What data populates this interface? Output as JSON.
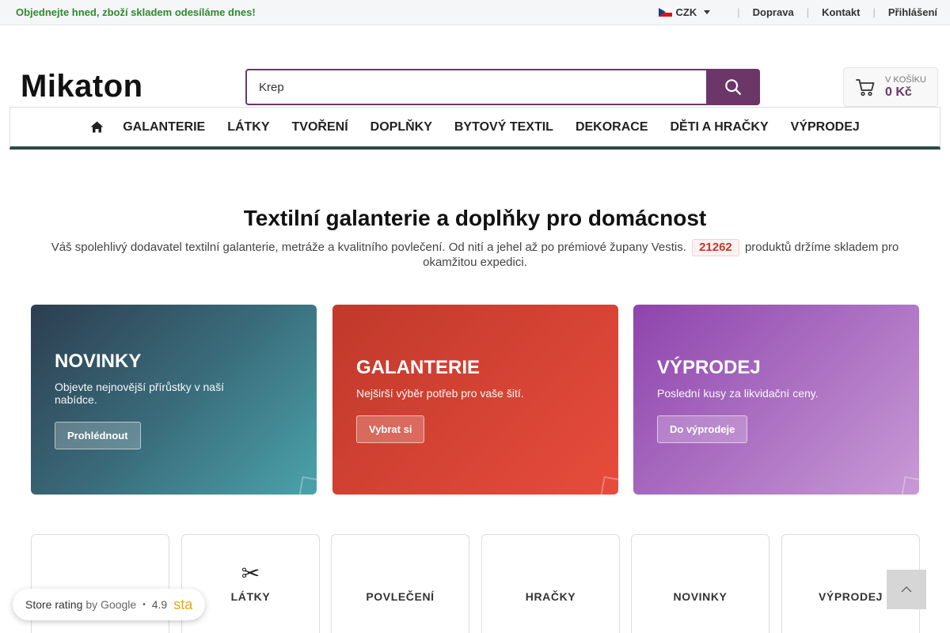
{
  "topbar": {
    "promo_icon": "",
    "promo_text": "Objednejte hned, zboží skladem odesíláme dnes!",
    "currency": "CZK",
    "links": [
      "Doprava",
      "Kontakt",
      "Přihlášení"
    ]
  },
  "header": {
    "logo": "Mikaton",
    "search_value": "Krep",
    "cart_label": "V KOŠÍKU",
    "cart_price": "0 Kč"
  },
  "nav": {
    "items": [
      "GALANTERIE",
      "LÁTKY",
      "TVOŘENÍ",
      "DOPLŇKY",
      "BYTOVÝ TEXTIL",
      "DEKORACE",
      "DĚTI A HRAČKY",
      "VÝPRODEJ"
    ]
  },
  "intro": {
    "title": "Textilní galanterie a doplňky pro domácnost",
    "text_before": "Váš spolehlivý dodavatel textilní galanterie, metráže a kvalitního povlečení. Od nití a jehel až po prémiové župany Vestis.",
    "product_count": "21262",
    "text_after": "produktů držíme skladem pro okamžitou expedici."
  },
  "banners": [
    {
      "title": "NOVINKY",
      "text": "Objevte nejnovější přírůstky v naší nabídce.",
      "button": "Prohlédnout"
    },
    {
      "title": "GALANTERIE",
      "text": "Nejširší výběr potřeb pro vaše šití.",
      "button": "Vybrat si"
    },
    {
      "title": "VÝPRODEJ",
      "text": "Poslední kusy za likvidační ceny.",
      "button": "Do výprodeje"
    }
  ],
  "categories": [
    {
      "icon": "",
      "label": ""
    },
    {
      "icon": "✂",
      "label": "LÁTKY"
    },
    {
      "icon": "",
      "label": "POVLEČENÍ"
    },
    {
      "icon": "",
      "label": "HRAČKY"
    },
    {
      "icon": "",
      "label": "NOVINKY"
    },
    {
      "icon": "",
      "label": "VÝPRODEJ"
    }
  ],
  "rating": {
    "label": "Store rating",
    "by": "by Google",
    "score": "4.9",
    "stars": "sta"
  },
  "colors": {
    "brand": "#6b3769",
    "nav_underline": "#2e4a46",
    "promo": "#2e8a2e",
    "badge_text": "#c0392b"
  },
  "icons": {
    "search": "search-icon",
    "cart": "cart-icon",
    "home": "home-icon",
    "back_to_top": "chevron-up-icon",
    "flag": "czech-flag-icon"
  }
}
